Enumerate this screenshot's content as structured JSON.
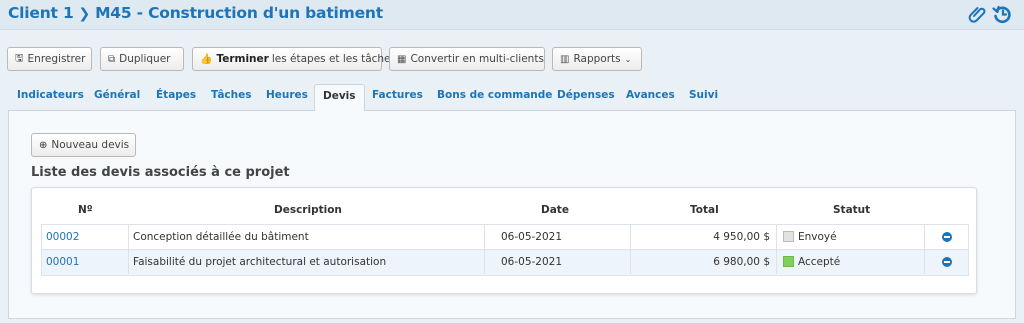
{
  "header": {
    "client": "Client 1",
    "project": "M45 - Construction d'un batiment",
    "icons": [
      "paperclip-icon",
      "history-icon"
    ]
  },
  "toolbar": {
    "save": "Enregistrer",
    "duplicate": "Dupliquer",
    "finish_bold": "Terminer",
    "finish_rest": "les étapes et les tâches",
    "convert": "Convertir en multi-clients",
    "reports": "Rapports"
  },
  "tabs": [
    "Indicateurs",
    "Général",
    "Étapes",
    "Tâches",
    "Heures",
    "Devis",
    "Factures",
    "Bons de commande",
    "Dépenses",
    "Avances",
    "Suivi"
  ],
  "active_tab": "Devis",
  "panel": {
    "new_button": "Nouveau devis",
    "section_title": "Liste des devis associés à ce projet"
  },
  "table": {
    "headers": {
      "number": "Nº",
      "description": "Description",
      "date": "Date",
      "total": "Total",
      "status": "Statut"
    },
    "rows": [
      {
        "number": "00002",
        "description": "Conception détaillée du bâtiment",
        "date": "06-05-2021",
        "total": "4 950,00 $",
        "status": "Envoyé",
        "status_color": "#e2e2e2"
      },
      {
        "number": "00001",
        "description": "Faisabilité du projet architectural et autorisation",
        "date": "06-05-2021",
        "total": "6 980,00 $",
        "status": "Accepté",
        "status_color": "#7fd15a"
      }
    ]
  },
  "colors": {
    "accent": "#1d74b7",
    "background": "#e9f0f6"
  }
}
